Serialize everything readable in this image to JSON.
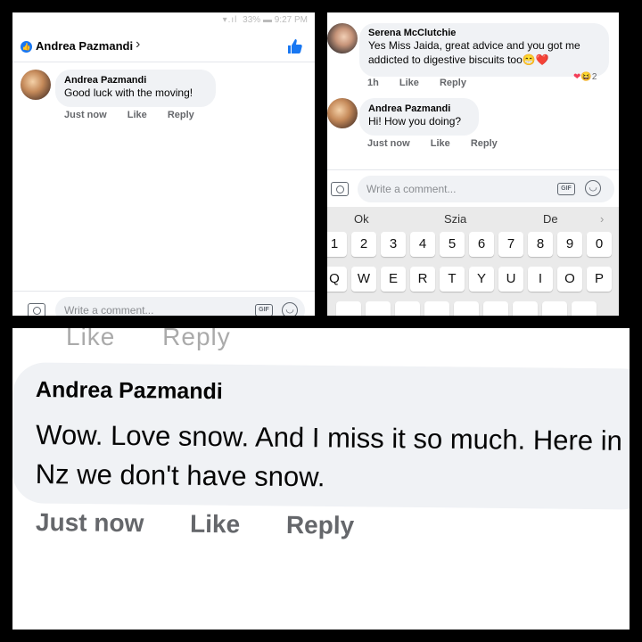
{
  "panel1": {
    "status": {
      "battery": "33%",
      "time": "9:27 PM"
    },
    "header": {
      "name": "Andrea Pazmandi"
    },
    "comment": {
      "author": "Andrea Pazmandi",
      "text": "Good luck with the moving!",
      "time": "Just now",
      "like": "Like",
      "reply": "Reply"
    },
    "input": {
      "placeholder": "Write a comment...",
      "gif": "GIF"
    }
  },
  "panel2": {
    "comment1": {
      "author": "Serena McClutchie",
      "text": "Yes Miss Jaida, great advice and you got me addicted to digestive biscuits too😁❤️",
      "time": "1h",
      "like": "Like",
      "reply": "Reply",
      "reaction_count": "2"
    },
    "comment2": {
      "author": "Andrea Pazmandi",
      "text": "Hi! How you doing?",
      "time": "Just now",
      "like": "Like",
      "reply": "Reply"
    },
    "input": {
      "placeholder": "Write a comment...",
      "gif": "GIF"
    },
    "keyboard": {
      "suggestions": [
        "Ok",
        "Szia",
        "De"
      ],
      "numbers": [
        "1",
        "2",
        "3",
        "4",
        "5",
        "6",
        "7",
        "8",
        "9",
        "0"
      ],
      "letters": [
        "Q",
        "W",
        "E",
        "R",
        "T",
        "Y",
        "U",
        "I",
        "O",
        "P"
      ]
    }
  },
  "panel3": {
    "cut_actions": {
      "like": "Like",
      "reply": "Reply"
    },
    "comment": {
      "author": "Andrea Pazmandi",
      "text": "Wow. Love snow. And I miss it so much. Here in Nz we don't have snow.",
      "time": "Just now",
      "like": "Like",
      "reply": "Reply"
    }
  },
  "colors": {
    "facebook_blue": "#1877f2",
    "bubble": "#f0f2f5",
    "meta": "#65676b"
  }
}
